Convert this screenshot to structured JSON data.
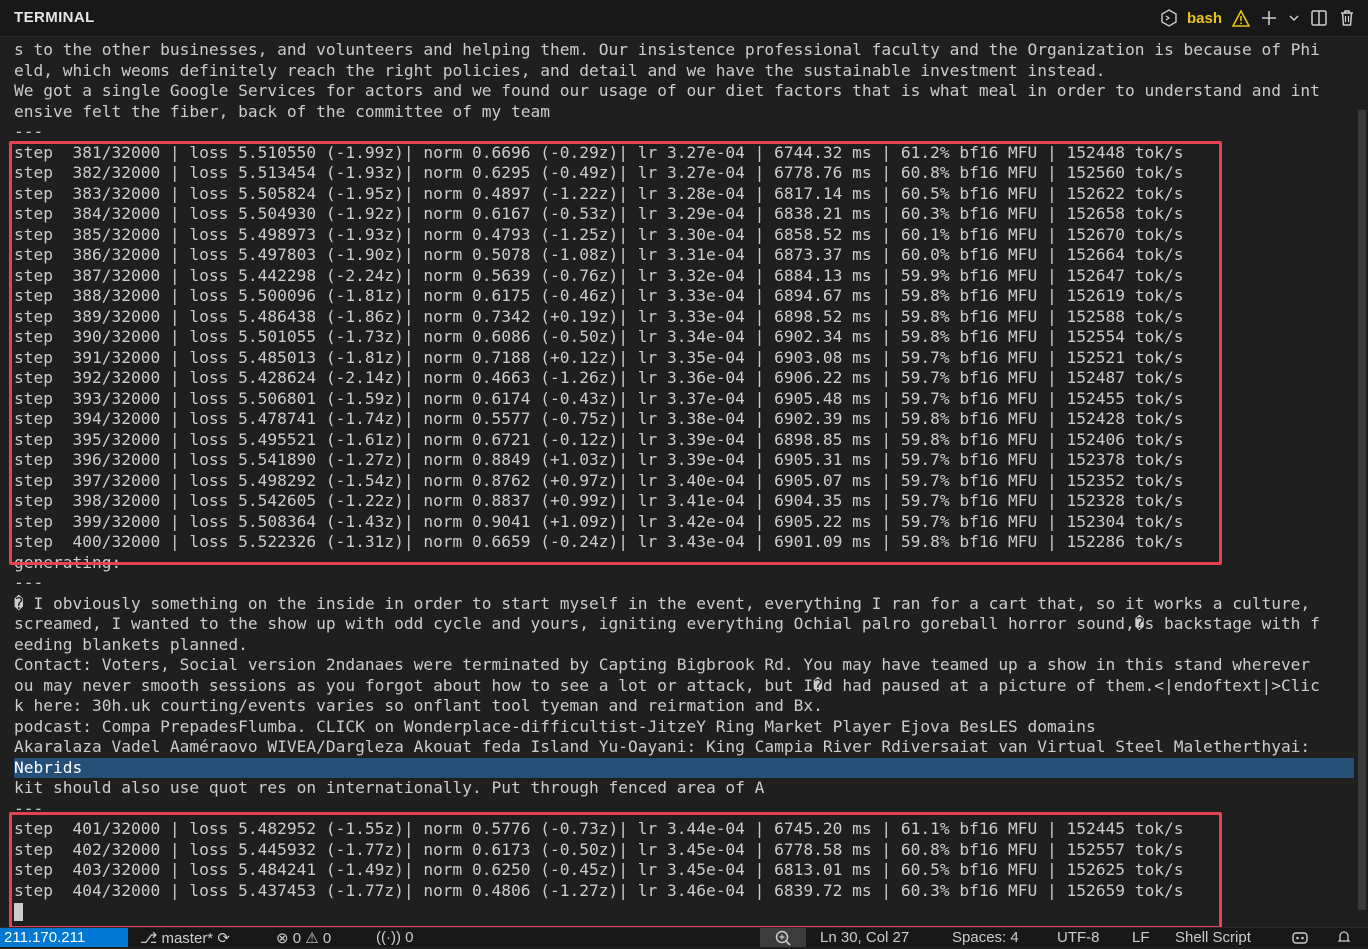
{
  "panel": {
    "title": "TERMINAL",
    "shell_name": "bash",
    "icons": [
      "bash-icon",
      "warning-icon",
      "plus-icon",
      "chevron-down-icon",
      "split-icon",
      "trash-icon"
    ]
  },
  "terminal": {
    "lines": [
      "s to the other businesses, and volunteers and helping them. Our insistence professional faculty and the Organization is because of Phi",
      "eld, which weoms definitely reach the right policies, and detail and we have the sustainable investment instead.",
      "We got a single Google Services for actors and we found our usage of our diet factors that is what meal in order to understand and int",
      "ensive felt the fiber, back of the committee of my team",
      "---",
      "step  381/32000 | loss 5.510550 (-1.99z)| norm 0.6696 (-0.29z)| lr 3.27e-04 | 6744.32 ms | 61.2% bf16 MFU | 152448 tok/s",
      "step  382/32000 | loss 5.513454 (-1.93z)| norm 0.6295 (-0.49z)| lr 3.27e-04 | 6778.76 ms | 60.8% bf16 MFU | 152560 tok/s",
      "step  383/32000 | loss 5.505824 (-1.95z)| norm 0.4897 (-1.22z)| lr 3.28e-04 | 6817.14 ms | 60.5% bf16 MFU | 152622 tok/s",
      "step  384/32000 | loss 5.504930 (-1.92z)| norm 0.6167 (-0.53z)| lr 3.29e-04 | 6838.21 ms | 60.3% bf16 MFU | 152658 tok/s",
      "step  385/32000 | loss 5.498973 (-1.93z)| norm 0.4793 (-1.25z)| lr 3.30e-04 | 6858.52 ms | 60.1% bf16 MFU | 152670 tok/s",
      "step  386/32000 | loss 5.497803 (-1.90z)| norm 0.5078 (-1.08z)| lr 3.31e-04 | 6873.37 ms | 60.0% bf16 MFU | 152664 tok/s",
      "step  387/32000 | loss 5.442298 (-2.24z)| norm 0.5639 (-0.76z)| lr 3.32e-04 | 6884.13 ms | 59.9% bf16 MFU | 152647 tok/s",
      "step  388/32000 | loss 5.500096 (-1.81z)| norm 0.6175 (-0.46z)| lr 3.33e-04 | 6894.67 ms | 59.8% bf16 MFU | 152619 tok/s",
      "step  389/32000 | loss 5.486438 (-1.86z)| norm 0.7342 (+0.19z)| lr 3.33e-04 | 6898.52 ms | 59.8% bf16 MFU | 152588 tok/s",
      "step  390/32000 | loss 5.501055 (-1.73z)| norm 0.6086 (-0.50z)| lr 3.34e-04 | 6902.34 ms | 59.8% bf16 MFU | 152554 tok/s",
      "step  391/32000 | loss 5.485013 (-1.81z)| norm 0.7188 (+0.12z)| lr 3.35e-04 | 6903.08 ms | 59.7% bf16 MFU | 152521 tok/s",
      "step  392/32000 | loss 5.428624 (-2.14z)| norm 0.4663 (-1.26z)| lr 3.36e-04 | 6906.22 ms | 59.7% bf16 MFU | 152487 tok/s",
      "step  393/32000 | loss 5.506801 (-1.59z)| norm 0.6174 (-0.43z)| lr 3.37e-04 | 6905.48 ms | 59.7% bf16 MFU | 152455 tok/s",
      "step  394/32000 | loss 5.478741 (-1.74z)| norm 0.5577 (-0.75z)| lr 3.38e-04 | 6902.39 ms | 59.8% bf16 MFU | 152428 tok/s",
      "step  395/32000 | loss 5.495521 (-1.61z)| norm 0.6721 (-0.12z)| lr 3.39e-04 | 6898.85 ms | 59.8% bf16 MFU | 152406 tok/s",
      "step  396/32000 | loss 5.541890 (-1.27z)| norm 0.8849 (+1.03z)| lr 3.39e-04 | 6905.31 ms | 59.7% bf16 MFU | 152378 tok/s",
      "step  397/32000 | loss 5.498292 (-1.54z)| norm 0.8762 (+0.97z)| lr 3.40e-04 | 6905.07 ms | 59.7% bf16 MFU | 152352 tok/s",
      "step  398/32000 | loss 5.542605 (-1.22z)| norm 0.8837 (+0.99z)| lr 3.41e-04 | 6904.35 ms | 59.7% bf16 MFU | 152328 tok/s",
      "step  399/32000 | loss 5.508364 (-1.43z)| norm 0.9041 (+1.09z)| lr 3.42e-04 | 6905.22 ms | 59.7% bf16 MFU | 152304 tok/s",
      "step  400/32000 | loss 5.522326 (-1.31z)| norm 0.6659 (-0.24z)| lr 3.43e-04 | 6901.09 ms | 59.8% bf16 MFU | 152286 tok/s",
      "generating:",
      "---",
      "� I obviously something on the inside in order to start myself in the event, everything I ran for a cart that, so it works a culture,",
      "screamed, I wanted to the show up with odd cycle and yours, igniting everything Ochial palro goreball horror sound,�s backstage with f",
      "eeding blankets planned.",
      "Contact: Voters, Social version 2ndanaes were terminated by Capting Bigbrook Rd. You may have teamed up a show in this stand wherever",
      "ou may never smooth sessions as you forgot about how to see a lot or attack, but I�d had paused at a picture of them.<|endoftext|>Clic",
      "k here: 30h.uk courting/events varies so onflant tool tyeman and reirmation and Bx.",
      "podcast: Compa PrepadesFlumba. CLICK on Wonderplace-difficultist-JitzeY Ring Market Player Ejova BesLES domains",
      "Akaralaza Vadel Aaméraovo WIVEA/Dargleza Akouat feda Island Yu-Oayani: King Campia River Rdiversaiat van Virtual Steel Maletherthyai:",
      "Nebrids",
      "kit should also use quot res on internationally. Put through fenced area of A",
      "---",
      "step  401/32000 | loss 5.482952 (-1.55z)| norm 0.5776 (-0.73z)| lr 3.44e-04 | 6745.20 ms | 61.1% bf16 MFU | 152445 tok/s",
      "step  402/32000 | loss 5.445932 (-1.77z)| norm 0.6173 (-0.50z)| lr 3.45e-04 | 6778.58 ms | 60.8% bf16 MFU | 152557 tok/s",
      "step  403/32000 | loss 5.484241 (-1.49z)| norm 0.6250 (-0.45z)| lr 3.45e-04 | 6813.01 ms | 60.5% bf16 MFU | 152625 tok/s",
      "step  404/32000 | loss 5.437453 (-1.77z)| norm 0.4806 (-1.27z)| lr 3.46e-04 | 6839.72 ms | 60.3% bf16 MFU | 152659 tok/s"
    ],
    "selected_line": 35,
    "highlight_color": "#e5434f",
    "selection_color": "#264f78"
  },
  "status_bar": {
    "remote": "211.170.211",
    "branch": "master*",
    "errors": "0",
    "warnings": "0",
    "ports": "0",
    "position": "Ln 30, Col 27",
    "spaces": "Spaces: 4",
    "encoding": "UTF-8",
    "eol": "LF",
    "language": "Shell Script",
    "accent_color": "#0078d4"
  }
}
